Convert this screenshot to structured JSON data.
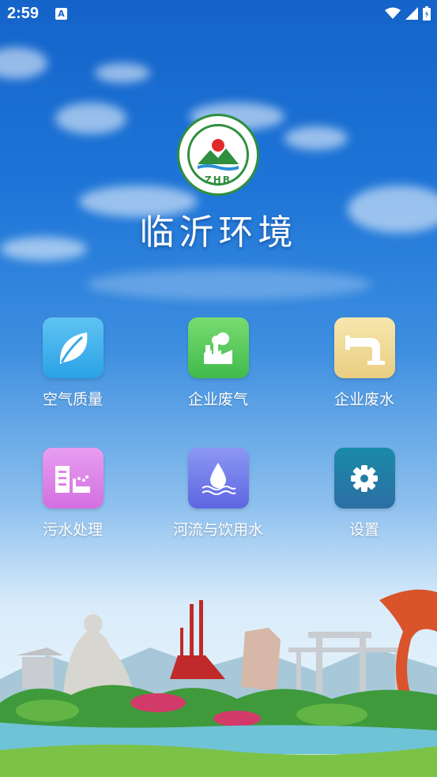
{
  "status_bar": {
    "time": "2:59",
    "notification_glyph": "A",
    "icons": [
      "wifi-icon",
      "signal-icon",
      "battery-icon"
    ]
  },
  "app": {
    "logo_text": "ZHB",
    "title": "临沂环境"
  },
  "menu": [
    {
      "label": "空气质量",
      "icon": "leaf-icon",
      "color": "#3cb0ec"
    },
    {
      "label": "企业废气",
      "icon": "factory-icon",
      "color": "#52c65a"
    },
    {
      "label": "企业废水",
      "icon": "pipe-icon",
      "color": "#eed68f"
    },
    {
      "label": "污水处理",
      "icon": "sewage-plant-icon",
      "color": "#dd84e8"
    },
    {
      "label": "河流与饮用水",
      "icon": "water-drop-icon",
      "color": "#737ee9"
    },
    {
      "label": "设置",
      "icon": "gear-icon",
      "color": "#237ca7"
    }
  ]
}
